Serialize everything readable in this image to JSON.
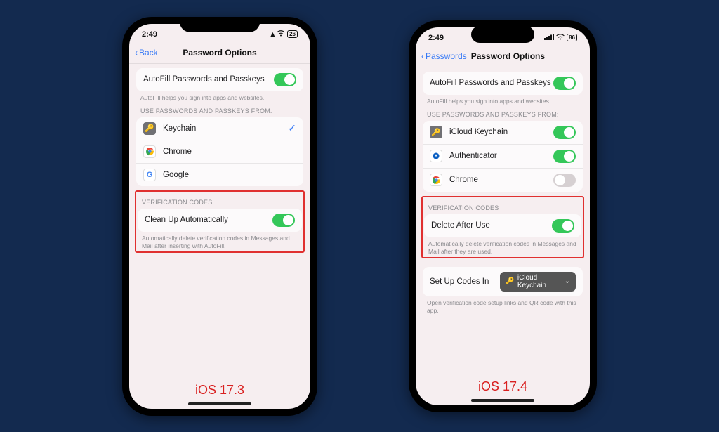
{
  "left": {
    "status": {
      "time": "2:49",
      "battery": "26"
    },
    "nav": {
      "back": "Back",
      "title": "Password Options"
    },
    "autofill": {
      "label": "AutoFill Passwords and Passkeys",
      "footer": "AutoFill helps you sign into apps and websites."
    },
    "sources": {
      "header": "USE PASSWORDS AND PASSKEYS FROM:",
      "items": [
        {
          "label": "Keychain",
          "selected": true
        },
        {
          "label": "Chrome",
          "selected": false
        },
        {
          "label": "Google",
          "selected": false
        }
      ]
    },
    "verification": {
      "header": "VERIFICATION CODES",
      "label": "Clean Up Automatically",
      "footer": "Automatically delete verification codes in Messages and Mail after inserting with AutoFill."
    },
    "version": "iOS 17.3"
  },
  "right": {
    "status": {
      "time": "2:49",
      "battery": "86"
    },
    "nav": {
      "back": "Passwords",
      "title": "Password Options"
    },
    "autofill": {
      "label": "AutoFill Passwords and Passkeys",
      "footer": "AutoFill helps you sign into apps and websites."
    },
    "sources": {
      "header": "USE PASSWORDS AND PASSKEYS FROM:",
      "items": [
        {
          "label": "iCloud Keychain",
          "on": true
        },
        {
          "label": "Authenticator",
          "on": true
        },
        {
          "label": "Chrome",
          "on": false
        }
      ]
    },
    "verification": {
      "header": "VERIFICATION CODES",
      "label": "Delete After Use",
      "footer": "Automatically delete verification codes in Messages and Mail after they are used."
    },
    "setup": {
      "label": "Set Up Codes In",
      "value": "iCloud Keychain",
      "footer": "Open verification code setup links and QR code with this app."
    },
    "version": "iOS 17.4"
  }
}
